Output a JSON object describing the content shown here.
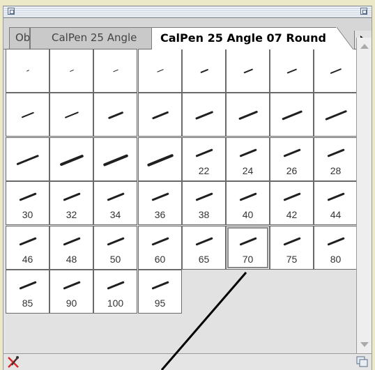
{
  "panel": {
    "tabs": [
      {
        "label": "Obje"
      },
      {
        "label": "CalPen 25 Angle"
      },
      {
        "label": "CalPen 25 Angle 07 Round"
      }
    ],
    "active_tab_index": 2
  },
  "brushes": [
    {
      "label": ""
    },
    {
      "label": ""
    },
    {
      "label": ""
    },
    {
      "label": ""
    },
    {
      "label": ""
    },
    {
      "label": ""
    },
    {
      "label": ""
    },
    {
      "label": ""
    },
    {
      "label": ""
    },
    {
      "label": ""
    },
    {
      "label": ""
    },
    {
      "label": ""
    },
    {
      "label": ""
    },
    {
      "label": ""
    },
    {
      "label": ""
    },
    {
      "label": ""
    },
    {
      "label": ""
    },
    {
      "label": ""
    },
    {
      "label": ""
    },
    {
      "label": ""
    },
    {
      "label": "22"
    },
    {
      "label": "24"
    },
    {
      "label": "26"
    },
    {
      "label": "28"
    },
    {
      "label": "30"
    },
    {
      "label": "32"
    },
    {
      "label": "34"
    },
    {
      "label": "36"
    },
    {
      "label": "38"
    },
    {
      "label": "40"
    },
    {
      "label": "42"
    },
    {
      "label": "44"
    },
    {
      "label": "46"
    },
    {
      "label": "48"
    },
    {
      "label": "50"
    },
    {
      "label": "60"
    },
    {
      "label": "65"
    },
    {
      "label": "70"
    },
    {
      "label": "75"
    },
    {
      "label": "80"
    },
    {
      "label": "85"
    },
    {
      "label": "90"
    },
    {
      "label": "100"
    },
    {
      "label": "95"
    }
  ],
  "selected_brush": "70",
  "colors": {
    "background": "#ece9c9",
    "panel": "#e5e5e5",
    "delete_icon": "#d62828"
  }
}
